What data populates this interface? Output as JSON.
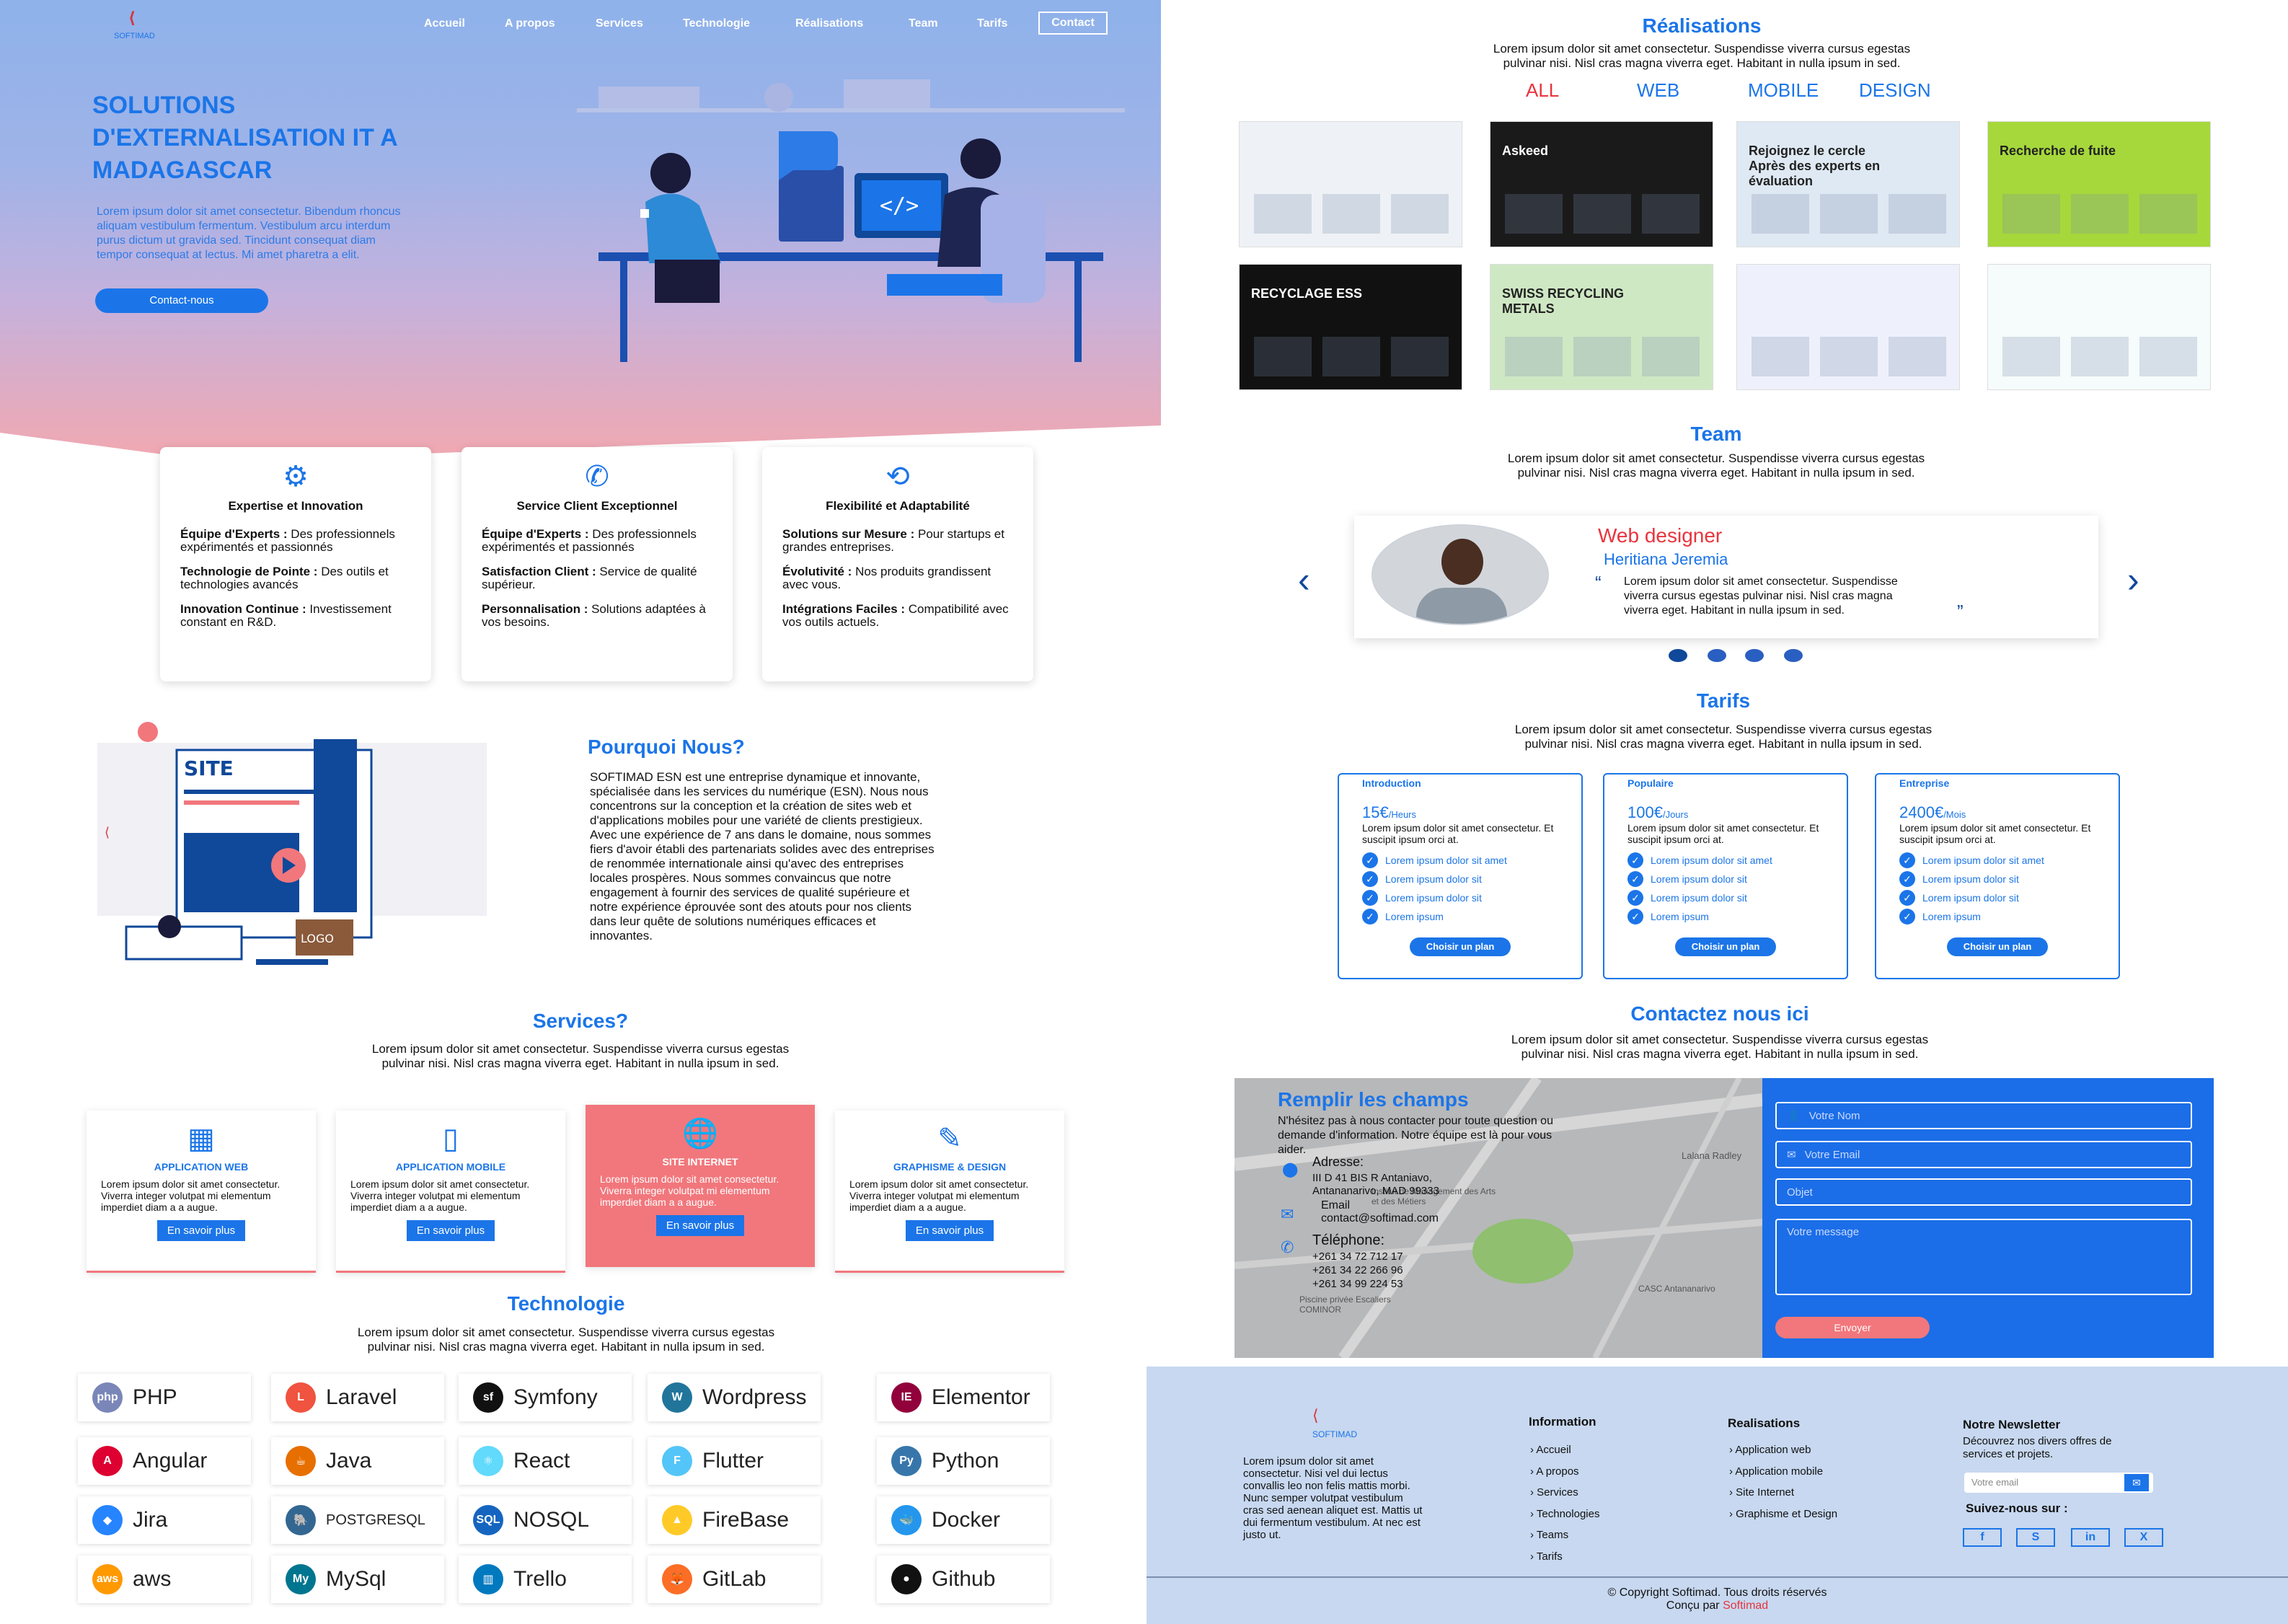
{
  "nav": {
    "logo_text": "SOFTIMAD",
    "links": [
      "Accueil",
      "A propos",
      "Services",
      "Technologie",
      "Réalisations",
      "Team",
      "Tarifs"
    ],
    "contact": "Contact"
  },
  "hero": {
    "title_lines": [
      "SOLUTIONS",
      "D'EXTERNALISATION IT A",
      "MADAGASCAR"
    ],
    "text_lines": [
      "Lorem ipsum dolor sit amet consectetur. Bibendum rhoncus",
      "aliquam vestibulum fermentum. Vestibulum arcu interdum",
      "purus dictum ut gravida sed. Tincidunt consequat diam",
      "tempor consequat at lectus. Mi amet pharetra a elit."
    ],
    "button": "Contact-nous"
  },
  "features": [
    {
      "icon": "gear-icon",
      "title": "Expertise et Innovation",
      "items": [
        [
          "Équipe d'Experts : ",
          "Des professionnels expérimentés et passionnés"
        ],
        [
          "Technologie de Pointe : ",
          "Des outils et technologies avancés"
        ],
        [
          "Innovation Continue : ",
          "Investissement constant en R&D."
        ]
      ]
    },
    {
      "icon": "phone-icon",
      "title": "Service Client Exceptionnel",
      "items": [
        [
          "Équipe d'Experts : ",
          "Des professionnels expérimentés et passionnés"
        ],
        [
          "Satisfaction Client : ",
          "Service de qualité supérieur."
        ],
        [
          "Personnalisation : ",
          "Solutions adaptées à vos besoins."
        ]
      ]
    },
    {
      "icon": "crop-icon",
      "title": "Flexibilité et Adaptabilité",
      "items": [
        [
          "Solutions sur Mesure : ",
          "Pour startups et grandes entreprises."
        ],
        [
          "Évolutivité : ",
          "Nos produits grandissent avec vous."
        ],
        [
          "Intégrations Faciles : ",
          "Compatibilité avec vos outils actuels."
        ]
      ]
    }
  ],
  "why": {
    "site_label": "SITE",
    "logo_label": "LOGO",
    "title": "Pourquoi Nous?",
    "lines": [
      "SOFTIMAD ESN est une entreprise dynamique et innovante,",
      "spécialisée dans les services du numérique (ESN). Nous nous",
      "concentrons sur la conception et la création de sites web et",
      "d'applications mobiles pour une variété de clients prestigieux.",
      "Avec une expérience de 7 ans dans le domaine, nous sommes",
      "fiers d'avoir établi des partenariats solides avec des entreprises",
      "de renommée internationale ainsi qu'avec des entreprises",
      "locales prospères. Nous sommes convaincus que notre",
      "engagement à fournir des services de qualité supérieure et",
      "notre expérience éprouvée sont des atouts pour nos clients",
      "dans leur quête de solutions numériques efficaces et",
      "innovantes."
    ]
  },
  "services": {
    "title": "Services?",
    "desc": [
      "Lorem ipsum dolor sit amet consectetur. Suspendisse viverra cursus egestas",
      "pulvinar nisi. Nisl cras magna viverra eget. Habitant in nulla ipsum in sed."
    ],
    "cards": [
      {
        "title": "APPLICATION WEB",
        "icon": "web-app-icon",
        "text": "Lorem ipsum dolor sit amet consectetur. Viverra integer volutpat mi elementum imperdiet diam a a augue.",
        "button": "En savoir plus"
      },
      {
        "title": "APPLICATION MOBILE",
        "icon": "mobile-app-icon",
        "text": "Lorem ipsum dolor sit amet consectetur. Viverra integer volutpat mi elementum imperdiet diam a a augue.",
        "button": "En savoir plus"
      },
      {
        "title": "SITE INTERNET",
        "icon": "globe-icon",
        "text": "Lorem ipsum dolor sit amet consectetur. Viverra integer volutpat mi elementum imperdiet diam a a augue.",
        "button": "En savoir plus"
      },
      {
        "title": "GRAPHISME & DESIGN",
        "icon": "design-icon",
        "text": "Lorem ipsum dolor sit amet consectetur. Viverra integer volutpat mi elementum imperdiet diam a a augue.",
        "button": "En savoir plus"
      }
    ]
  },
  "technology": {
    "title": "Technologie",
    "desc": [
      "Lorem ipsum dolor sit amet consectetur. Suspendisse viverra cursus egestas",
      "pulvinar nisi. Nisl cras magna viverra eget. Habitant in nulla ipsum in sed."
    ],
    "items": [
      {
        "name": "PHP",
        "icon": "php-icon",
        "color": "#7a86b8",
        "glyph": "php"
      },
      {
        "name": "Laravel",
        "icon": "laravel-icon",
        "color": "#f0533f",
        "glyph": "L"
      },
      {
        "name": "Symfony",
        "icon": "symfony-icon",
        "color": "#111111",
        "glyph": "sf"
      },
      {
        "name": "Wordpress",
        "icon": "wordpress-icon",
        "color": "#21759b",
        "glyph": "W"
      },
      {
        "name": "Elementor",
        "icon": "elementor-icon",
        "color": "#92003b",
        "glyph": "IE"
      },
      {
        "name": "Angular",
        "icon": "angular-icon",
        "color": "#dd0031",
        "glyph": "A"
      },
      {
        "name": "Java",
        "icon": "java-icon",
        "color": "#e76f00",
        "glyph": "☕"
      },
      {
        "name": "React",
        "icon": "react-icon",
        "color": "#61dafb",
        "glyph": "⚛"
      },
      {
        "name": "Flutter",
        "icon": "flutter-icon",
        "color": "#54c5f8",
        "glyph": "F"
      },
      {
        "name": "Python",
        "icon": "python-icon",
        "color": "#3776ab",
        "glyph": "Py"
      },
      {
        "name": "Jira",
        "icon": "jira-icon",
        "color": "#2684ff",
        "glyph": "◆"
      },
      {
        "name": "POSTGRESQL",
        "icon": "postgresql-icon",
        "color": "#336791",
        "glyph": "🐘"
      },
      {
        "name": "NOSQL",
        "icon": "nosql-icon",
        "color": "#1565c0",
        "glyph": "SQL"
      },
      {
        "name": "FireBase",
        "icon": "firebase-icon",
        "color": "#ffca28",
        "glyph": "▲"
      },
      {
        "name": "Docker",
        "icon": "docker-icon",
        "color": "#2496ed",
        "glyph": "🐳"
      },
      {
        "name": "aws",
        "icon": "aws-icon",
        "color": "#ff9900",
        "glyph": "aws"
      },
      {
        "name": "MySql",
        "icon": "mysql-icon",
        "color": "#00758f",
        "glyph": "My"
      },
      {
        "name": "Trello",
        "icon": "trello-icon",
        "color": "#0079bf",
        "glyph": "▥"
      },
      {
        "name": "GitLab",
        "icon": "gitlab-icon",
        "color": "#fc6d26",
        "glyph": "🦊"
      },
      {
        "name": "Github",
        "icon": "github-icon",
        "color": "#111111",
        "glyph": "●"
      }
    ]
  },
  "realisations": {
    "title": "Réalisations",
    "desc": [
      "Lorem ipsum dolor sit amet consectetur. Suspendisse viverra cursus egestas",
      "pulvinar nisi. Nisl cras magna viverra eget. Habitant in nulla ipsum in sed."
    ],
    "filters": [
      "ALL",
      "WEB",
      "MOBILE",
      "DESIGN"
    ],
    "thumbs": [
      {
        "caption": "",
        "bg": "#eef2f6"
      },
      {
        "caption": "Askeed",
        "bg": "#1a1a1a"
      },
      {
        "caption": "Rejoignez le cercle Après des experts en évaluation",
        "bg": "#dfe9f3"
      },
      {
        "caption": "Recherche de fuite",
        "bg": "#a6d83b"
      },
      {
        "caption": "RECYCLAGE ESS",
        "bg": "#111111"
      },
      {
        "caption": "SWISS RECYCLING METALS",
        "bg": "#cfe8c4"
      },
      {
        "caption": "",
        "bg": "#eef1fb"
      },
      {
        "caption": "",
        "bg": "#f6fbfb"
      }
    ]
  },
  "team": {
    "title": "Team",
    "desc": [
      "Lorem ipsum dolor sit amet consectetur. Suspendisse viverra cursus egestas",
      "pulvinar nisi. Nisl cras magna viverra eget. Habitant in nulla ipsum in sed."
    ],
    "role": "Web designer",
    "name": "Heritiana Jeremia",
    "quote_lines": [
      "Lorem ipsum dolor sit amet consectetur. Suspendisse",
      "viverra cursus egestas pulvinar nisi. Nisl cras magna",
      "viverra eget. Habitant in nulla ipsum in sed."
    ]
  },
  "pricing": {
    "title": "Tarifs",
    "desc": [
      "Lorem ipsum dolor sit amet consectetur. Suspendisse viverra cursus egestas",
      "pulvinar nisi. Nisl cras magna viverra eget. Habitant in nulla ipsum in sed."
    ],
    "plans": [
      {
        "name": "Introduction",
        "price": "15€",
        "unit": "/Heurs",
        "text": "Lorem ipsum dolor sit amet consectetur. Et suscipit ipsum orci at.",
        "features": [
          "Lorem ipsum dolor sit amet",
          "Lorem ipsum dolor sit",
          "Lorem ipsum dolor sit",
          "Lorem ipsum"
        ],
        "button": "Choisir un plan"
      },
      {
        "name": "Populaire",
        "price": "100€",
        "unit": "/Jours",
        "text": "Lorem ipsum dolor sit amet consectetur. Et suscipit ipsum orci at.",
        "features": [
          "Lorem ipsum dolor sit amet",
          "Lorem ipsum dolor sit",
          "Lorem ipsum dolor sit",
          "Lorem ipsum"
        ],
        "button": "Choisir un plan"
      },
      {
        "name": "Entreprise",
        "price": "2400€",
        "unit": "/Mois",
        "text": "Lorem ipsum dolor sit amet consectetur. Et suscipit ipsum orci at.",
        "features": [
          "Lorem ipsum dolor sit amet",
          "Lorem ipsum dolor sit",
          "Lorem ipsum dolor sit",
          "Lorem ipsum"
        ],
        "button": "Choisir un plan"
      }
    ]
  },
  "contact": {
    "title": "Contactez nous ici",
    "desc": [
      "Lorem ipsum dolor sit amet consectetur. Suspendisse viverra cursus egestas",
      "pulvinar nisi. Nisl cras magna viverra eget. Habitant in nulla ipsum in sed."
    ],
    "panel_title": "Remplir les champs",
    "panel_text": [
      "N'hésitez pas à nous contacter pour toute question ou",
      "demande d'information. Notre équipe est là pour vous",
      "aider."
    ],
    "address_label": "Adresse:",
    "address": [
      "III D 41 BIS R Antaniavo,",
      "Antananarivo, MAD 99333"
    ],
    "email_label": "Email",
    "email": "contact@softimad.com",
    "phone_label": "Téléphone:",
    "phones": [
      "+261 34 72 712 17",
      "+261 34 22 266 96",
      "+261 34 99 224 53"
    ],
    "map_labels": [
      "Lalana Radley",
      "Piscine privée Escaliers COMINOR",
      "CASC Antananarivo",
      "Institut de Management des Arts et des Métiers"
    ],
    "form": {
      "name": "Votre Nom",
      "email": "Votre Email",
      "subject": "Objet",
      "message": "Votre message",
      "submit": "Envoyer"
    }
  },
  "footer": {
    "logo_text": "SOFTIMAD",
    "about_lines": [
      "Lorem ipsum dolor sit amet",
      "consectetur. Nisi vel dui lectus",
      "convallis leo non felis mattis morbi.",
      "Nunc semper volutpat vestibulum",
      "cras sed aenean aliquet est. Mattis ut",
      "dui fermentum vestibulum. At nec est",
      "justo ut."
    ],
    "information_title": "Information",
    "information_links": [
      "Accueil",
      "A propos",
      "Services",
      "Technologies",
      "Teams",
      "Tarifs"
    ],
    "realisations_title": "Realisations",
    "realisations_links": [
      "Application web",
      "Application mobile",
      "Site Internet",
      "Graphisme et Design"
    ],
    "newsletter_title": "Notre Newsletter",
    "newsletter_text": [
      "Découvrez nos divers offres de",
      "services et projets."
    ],
    "newsletter_placeholder": "Votre email",
    "social_title": "Suivez-nous sur :",
    "socials": [
      "f",
      "S",
      "in",
      "X"
    ],
    "copyright": "© Copyright Softimad. Tous droits réservés",
    "made_by": "Conçu par ",
    "made_by_name": "Softimad"
  }
}
